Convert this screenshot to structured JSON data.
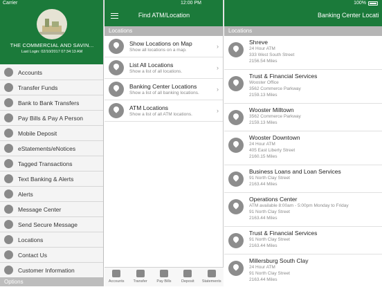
{
  "status_bar": {
    "carrier": "Carrier",
    "time": "12:00 PM",
    "battery": "100%"
  },
  "colors": {
    "brand_green": "#1b7a3a",
    "section_gray": "#b5b5b5"
  },
  "menu": {
    "bank_name": "THE COMMERCIAL AND SAVIN...",
    "last_login": "Last Login: 02/10/2017 07:34:13 AM",
    "items": [
      {
        "label": "Accounts",
        "icon": "accounts-icon"
      },
      {
        "label": "Transfer Funds",
        "icon": "transfer-icon"
      },
      {
        "label": "Bank to Bank Transfers",
        "icon": "bank-transfer-icon"
      },
      {
        "label": "Pay Bills & Pay A Person",
        "icon": "bill-pay-icon"
      },
      {
        "label": "Mobile Deposit",
        "icon": "camera-icon"
      },
      {
        "label": "eStatements/eNotices",
        "icon": "statement-icon"
      },
      {
        "label": "Tagged Transactions",
        "icon": "tag-icon"
      },
      {
        "label": "Text Banking & Alerts",
        "icon": "text-icon"
      },
      {
        "label": "Alerts",
        "icon": "bell-icon"
      },
      {
        "label": "Message Center",
        "icon": "message-icon"
      },
      {
        "label": "Send Secure Message",
        "icon": "send-icon"
      },
      {
        "label": "Locations",
        "icon": "location-icon"
      },
      {
        "label": "Contact Us",
        "icon": "phone-icon"
      },
      {
        "label": "Customer Information",
        "icon": "info-icon"
      }
    ],
    "options_label": "Options"
  },
  "middle": {
    "title": "Find ATM/Location",
    "section": "Locations",
    "options": [
      {
        "title": "Show Locations on Map",
        "subtitle": "Show all locations on a map."
      },
      {
        "title": "List All Locations",
        "subtitle": "Show a list of all locations."
      },
      {
        "title": "Banking Center Locations",
        "subtitle": "Show a list of all banking locations."
      },
      {
        "title": "ATM Locations",
        "subtitle": "Show a list of all ATM locations."
      }
    ],
    "tabs": [
      "Accounts",
      "Transfer",
      "Pay Bills",
      "Deposit",
      "Statements"
    ]
  },
  "right": {
    "title": "Banking Center Locati",
    "section": "Locations",
    "locations": [
      {
        "name": "Shreve",
        "lines": [
          "24 Hour ATM",
          "333 West South Street",
          "2156.54 Miles"
        ]
      },
      {
        "name": "Trust & Financial Services",
        "lines": [
          "Wooster Office",
          "3562 Commerce Parkway",
          "2159.13 Miles"
        ]
      },
      {
        "name": "Wooster Milltown",
        "lines": [
          "3562 Commerce Parkway",
          "2159.13 Miles"
        ]
      },
      {
        "name": "Wooster Downtown",
        "lines": [
          "24 Hour ATM",
          "405 East Liberty Street",
          "2160.15 Miles"
        ]
      },
      {
        "name": "Business Loans and Loan Services",
        "lines": [
          "91 North Clay Street",
          "2163.44 Miles"
        ]
      },
      {
        "name": "Operations Center",
        "lines": [
          "ATM available 8:00am - 5:00pm Monday to Friday",
          "91 North Clay Street",
          "2163.44 Miles"
        ]
      },
      {
        "name": "Trust & Financial Services",
        "lines": [
          "91 North Clay Street",
          "2163.44 Miles"
        ]
      },
      {
        "name": "Millersburg South Clay",
        "lines": [
          "24 Hour ATM",
          "91 North Clay Street",
          "2163.44 Miles"
        ]
      }
    ]
  }
}
